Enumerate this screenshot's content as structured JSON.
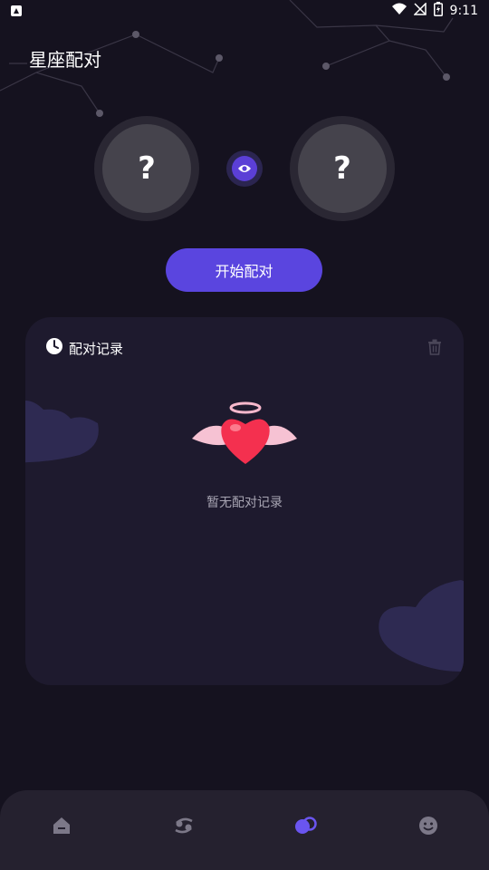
{
  "status_bar": {
    "time": "9:11"
  },
  "header": {
    "title": "星座配对"
  },
  "pair": {
    "left_placeholder": "?",
    "right_placeholder": "?",
    "start_button_label": "开始配对"
  },
  "record": {
    "title": "配对记录",
    "empty_text": "暂无配对记录"
  },
  "nav": {
    "items": [
      {
        "icon": "home-icon",
        "active": false
      },
      {
        "icon": "cancer-zodiac-icon",
        "active": false
      },
      {
        "icon": "pair-icon",
        "active": true
      },
      {
        "icon": "smiley-icon",
        "active": false
      }
    ]
  },
  "colors": {
    "background": "#15121f",
    "accent": "#5a45df",
    "card": "#1e1a2e",
    "nav_inactive": "#7c7888",
    "nav_active": "#6a55f0"
  }
}
